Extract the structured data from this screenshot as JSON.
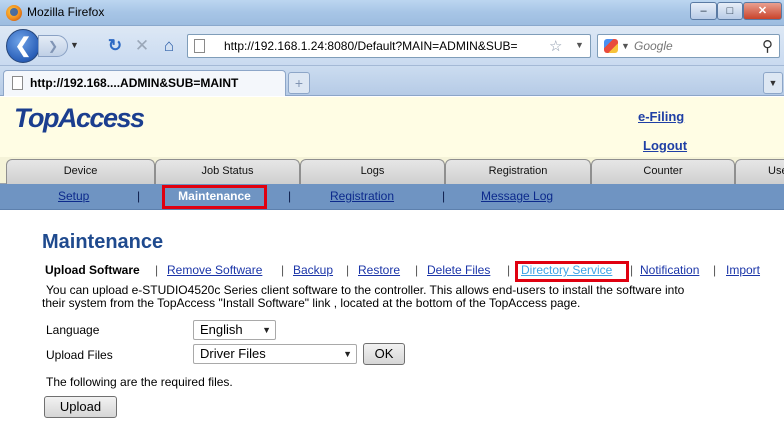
{
  "window": {
    "title": "Mozilla Firefox"
  },
  "nav": {
    "url": "http://192.168.1.24:8080/Default?MAIN=ADMIN&SUB=",
    "search_placeholder": "Google"
  },
  "tab": {
    "label": "http://192.168....ADMIN&SUB=MAINT"
  },
  "header": {
    "logo": "TopAccess",
    "efiling": "e-Filing",
    "logout": "Logout"
  },
  "main_menu": {
    "items": [
      {
        "label": "Device"
      },
      {
        "label": "Job Status"
      },
      {
        "label": "Logs"
      },
      {
        "label": "Registration"
      },
      {
        "label": "Counter"
      },
      {
        "label": "Use"
      }
    ]
  },
  "submenu": {
    "items": [
      {
        "label": "Setup"
      },
      {
        "label": "Maintenance"
      },
      {
        "label": "Registration"
      },
      {
        "label": "Message Log"
      }
    ],
    "sep": "|"
  },
  "content": {
    "title": "Maintenance",
    "crumbs": [
      {
        "label": "Upload Software"
      },
      {
        "label": "Remove Software"
      },
      {
        "label": "Backup"
      },
      {
        "label": "Restore"
      },
      {
        "label": "Delete Files"
      },
      {
        "label": "Directory Service"
      },
      {
        "label": "Notification"
      },
      {
        "label": "Import"
      }
    ],
    "sep": "|",
    "description_line1": "You can upload e-STUDIO4520c Series client software to the controller. This allows end-users to install the software into",
    "description_line2": "their system from the TopAccess \"Install Software\" link , located at the bottom of the TopAccess page.",
    "language_label": "Language",
    "language_value": "English",
    "upload_files_label": "Upload Files",
    "upload_files_value": "Driver Files",
    "ok_label": "OK",
    "note": "The following are the required files.",
    "upload_label": "Upload"
  }
}
